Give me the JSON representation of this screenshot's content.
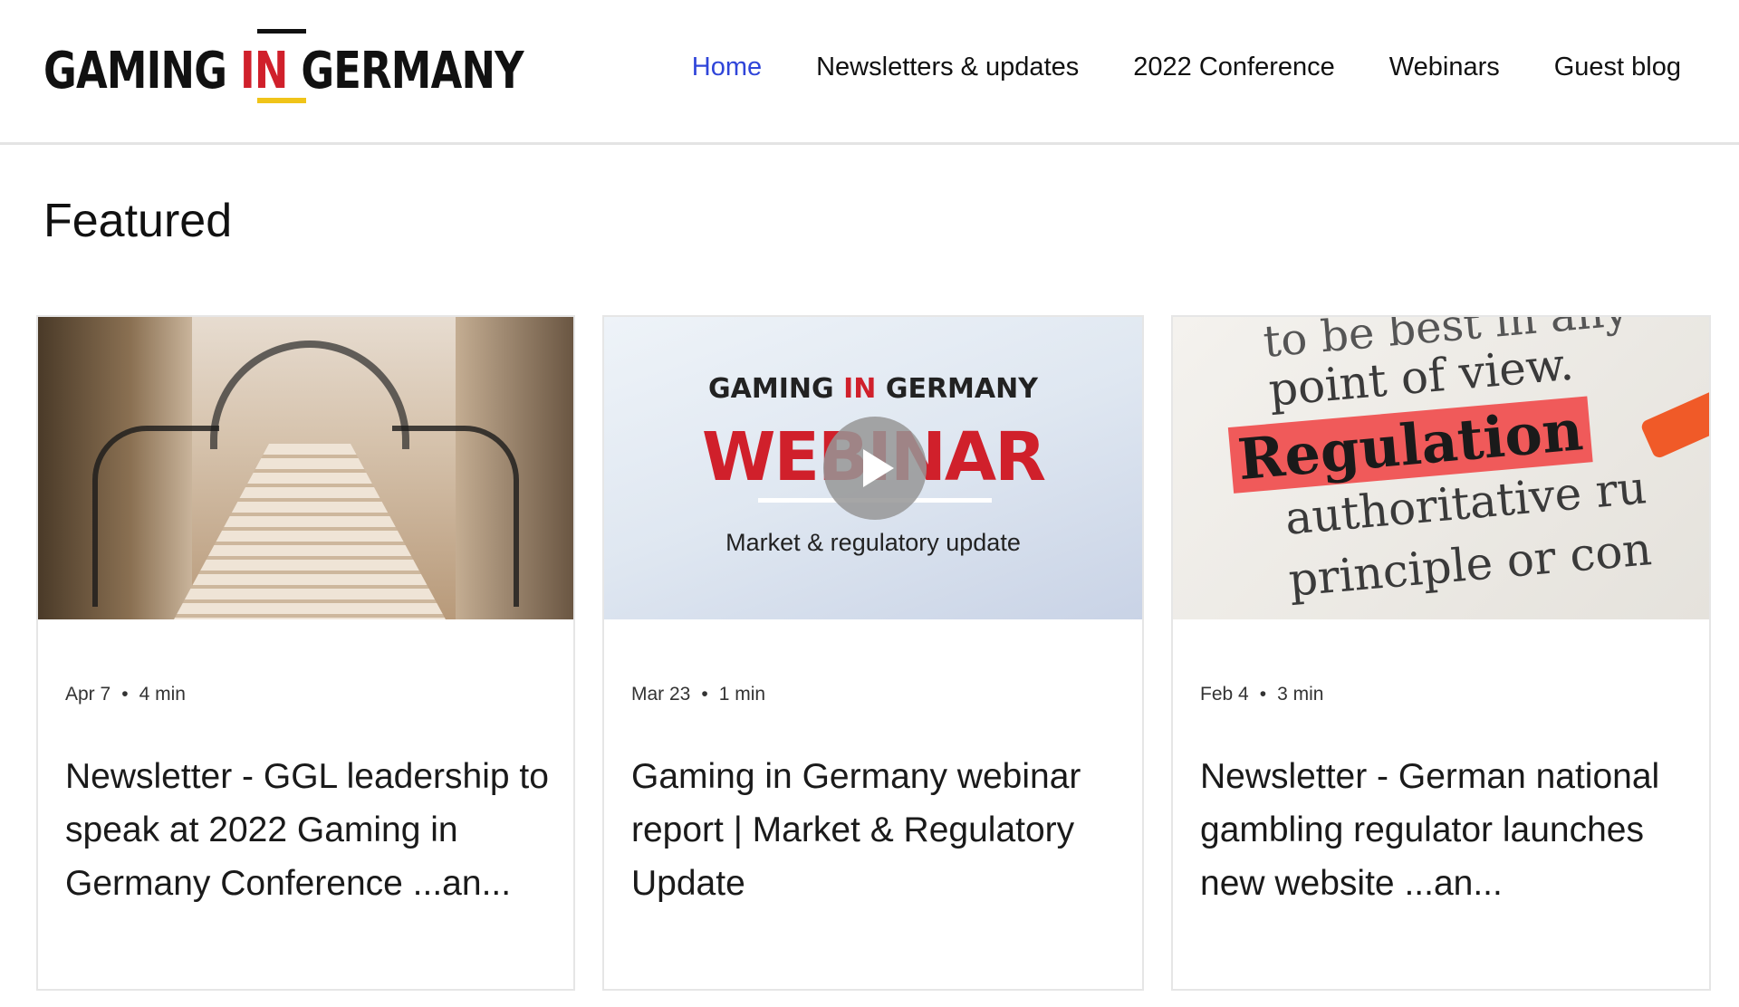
{
  "header": {
    "logo": {
      "part1": "GAMING",
      "part2": "IN",
      "part3": "GERMANY"
    },
    "nav": [
      {
        "label": "Home",
        "active": true
      },
      {
        "label": "Newsletters & updates",
        "active": false
      },
      {
        "label": "2022 Conference",
        "active": false
      },
      {
        "label": "Webinars",
        "active": false
      },
      {
        "label": "Guest blog",
        "active": false
      }
    ]
  },
  "featured": {
    "heading": "Featured",
    "posts": [
      {
        "date": "Apr 7",
        "read_time": "4 min",
        "title": "Newsletter - GGL leadership to speak at 2022 Gaming in Germany Conference ...an...",
        "image": "staircase-photo"
      },
      {
        "date": "Mar 23",
        "read_time": "1 min",
        "title": "Gaming in Germany webinar report | Market & Regulatory Update",
        "image": "webinar-video-thumbnail",
        "image_text": {
          "logo_part1": "GAMING",
          "logo_part2": "IN",
          "logo_part3": "GERMANY",
          "big": "WEBINAR",
          "subtitle": "Market & regulatory update"
        }
      },
      {
        "date": "Feb 4",
        "read_time": "3 min",
        "title": "Newsletter - German national gambling regulator launches new website ...an...",
        "image": "regulation-dictionary-photo",
        "image_text": {
          "l1": "to be best in any",
          "l2": "point of view.",
          "l3": "Regulation",
          "l4": "authoritative ru",
          "l5": "principle or con"
        }
      }
    ]
  },
  "colors": {
    "nav_active": "#2f45d9",
    "brand_red": "#d0202b",
    "brand_gold": "#f0c419"
  }
}
